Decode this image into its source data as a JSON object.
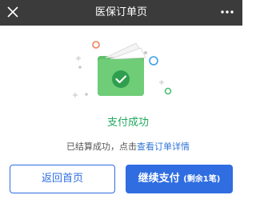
{
  "header": {
    "title": "医保订单页",
    "close_icon": "close-icon",
    "more_icon": "more-icon"
  },
  "status": {
    "text": "支付成功",
    "color": "#22a95f"
  },
  "hint": {
    "prefix": "已结算成功，点击",
    "link": "查看订单详情"
  },
  "buttons": {
    "back": "返回首页",
    "continue": "继续支付",
    "continue_sub": "(剩余1笔)"
  },
  "colors": {
    "accent": "#2f6de1",
    "topbar": "#3b3b3b",
    "success": "#22a95f"
  }
}
